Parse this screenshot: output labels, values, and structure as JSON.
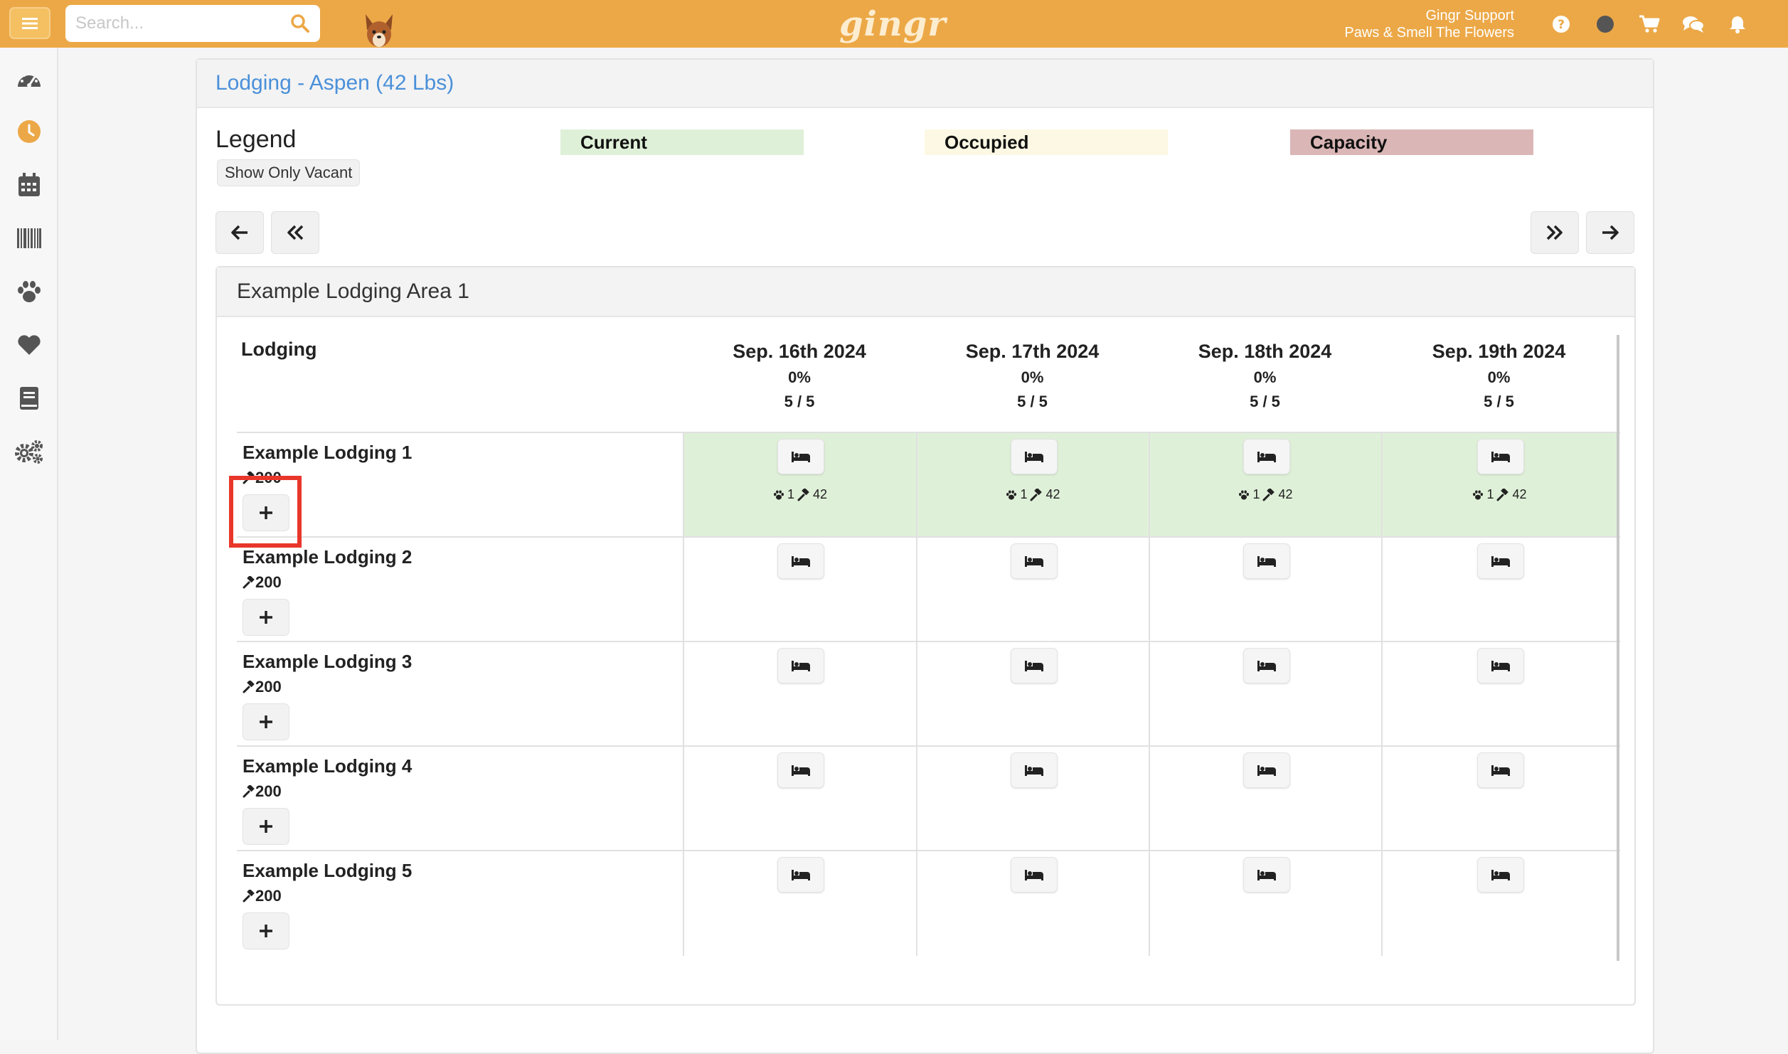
{
  "topbar": {
    "search_placeholder": "Search...",
    "logo": "gingr",
    "user_name": "Gingr Support",
    "location": "Paws & Smell The Flowers",
    "icons": [
      "question-circle-icon",
      "circle-icon",
      "cart-icon",
      "chat-icon",
      "bell-icon"
    ]
  },
  "sidebar": {
    "items": [
      "dashboard-icon",
      "clock-icon",
      "calendar-icon",
      "barcode-icon",
      "paw-icon",
      "heart-icon",
      "book-icon",
      "gears-icon"
    ],
    "active": "clock-icon"
  },
  "panel": {
    "title": "Lodging - Aspen (42 Lbs)"
  },
  "legend": {
    "title": "Legend",
    "show_vacant": "Show Only Vacant",
    "items": [
      {
        "label": "Current",
        "color": "#dff0d8"
      },
      {
        "label": "Occupied",
        "color": "#fcf8e3"
      },
      {
        "label": "Capacity",
        "color": "#dbb6b6"
      }
    ]
  },
  "area": {
    "title": "Example Lodging Area 1",
    "col_header": "Lodging",
    "dates": [
      {
        "date": "Sep. 16th 2024",
        "pct": "0%",
        "count": "5 / 5"
      },
      {
        "date": "Sep. 17th 2024",
        "pct": "0%",
        "count": "5 / 5"
      },
      {
        "date": "Sep. 18th 2024",
        "pct": "0%",
        "count": "5 / 5"
      },
      {
        "date": "Sep. 19th 2024",
        "pct": "0%",
        "count": "5 / 5"
      }
    ],
    "rows": [
      {
        "name": "Example Lodging 1",
        "capacity": "200",
        "current": true,
        "stats": {
          "pets": "1",
          "weight": "42"
        }
      },
      {
        "name": "Example Lodging 2",
        "capacity": "200",
        "current": false
      },
      {
        "name": "Example Lodging 3",
        "capacity": "200",
        "current": false
      },
      {
        "name": "Example Lodging 4",
        "capacity": "200",
        "current": false
      },
      {
        "name": "Example Lodging 5",
        "capacity": "200",
        "current": false
      }
    ]
  },
  "add_symbol": "+"
}
